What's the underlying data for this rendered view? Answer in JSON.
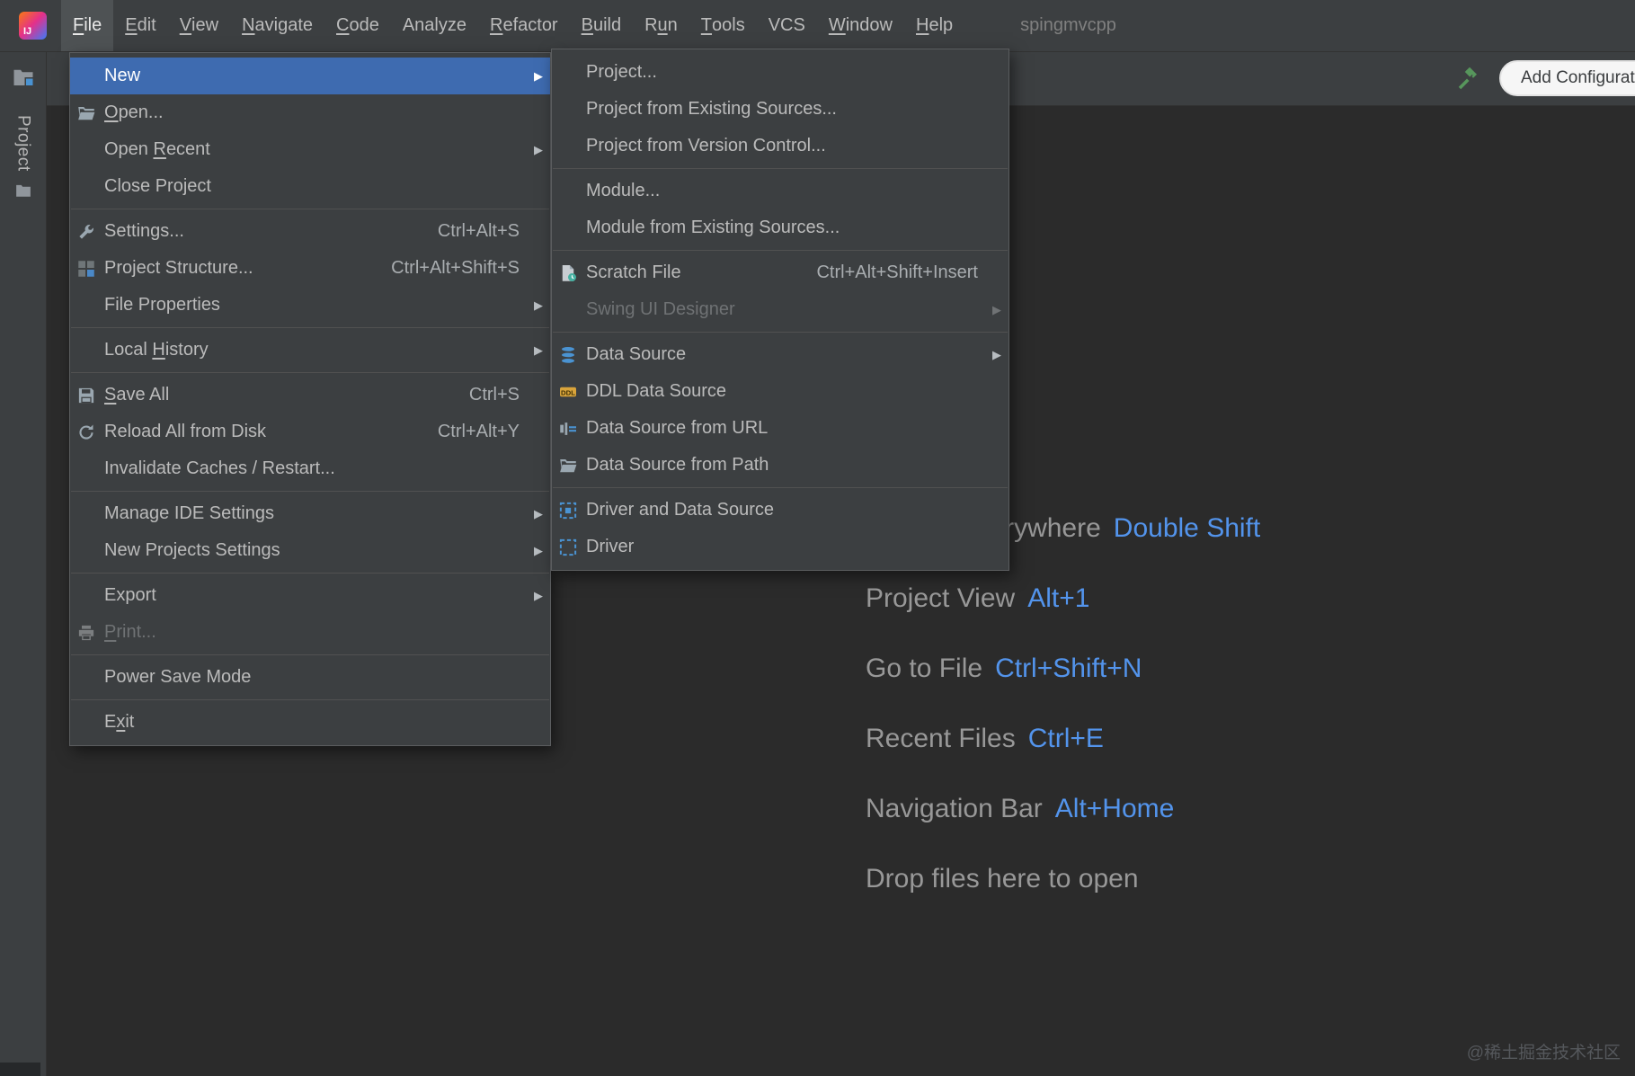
{
  "menubar": {
    "active": "File",
    "items": [
      {
        "label": "File",
        "mnemonic": 0
      },
      {
        "label": "Edit",
        "mnemonic": 0
      },
      {
        "label": "View",
        "mnemonic": 0
      },
      {
        "label": "Navigate",
        "mnemonic": 0
      },
      {
        "label": "Code",
        "mnemonic": 0
      },
      {
        "label": "Analyze",
        "mnemonic": null
      },
      {
        "label": "Refactor",
        "mnemonic": 0
      },
      {
        "label": "Build",
        "mnemonic": 0
      },
      {
        "label": "Run",
        "mnemonic": 1
      },
      {
        "label": "Tools",
        "mnemonic": 0
      },
      {
        "label": "VCS",
        "mnemonic": null
      },
      {
        "label": "Window",
        "mnemonic": 0
      },
      {
        "label": "Help",
        "mnemonic": 0
      }
    ],
    "project_name": "spingmvcpp"
  },
  "toolbar": {
    "add_config_label": "Add Configuration...",
    "hammer_icon": "hammer-icon"
  },
  "sidebar": {
    "tool_window_label": "Project"
  },
  "file_menu": {
    "items": [
      {
        "label": "New",
        "submenu": true,
        "selected": true
      },
      {
        "label": "Open...",
        "icon": "folder-open-icon",
        "mnemonic": 0
      },
      {
        "label": "Open Recent",
        "submenu": true,
        "mnemonic": 5
      },
      {
        "label": "Close Project"
      },
      {
        "separator": true
      },
      {
        "label": "Settings...",
        "icon": "wrench-icon",
        "shortcut": "Ctrl+Alt+S"
      },
      {
        "label": "Project Structure...",
        "icon": "project-structure-icon",
        "shortcut": "Ctrl+Alt+Shift+S"
      },
      {
        "label": "File Properties",
        "submenu": true
      },
      {
        "separator": true
      },
      {
        "label": "Local History",
        "submenu": true,
        "mnemonic": 6
      },
      {
        "separator": true
      },
      {
        "label": "Save All",
        "icon": "save-icon",
        "shortcut": "Ctrl+S",
        "mnemonic": 0
      },
      {
        "label": "Reload All from Disk",
        "icon": "reload-icon",
        "shortcut": "Ctrl+Alt+Y"
      },
      {
        "label": "Invalidate Caches / Restart..."
      },
      {
        "separator": true
      },
      {
        "label": "Manage IDE Settings",
        "submenu": true
      },
      {
        "label": "New Projects Settings",
        "submenu": true
      },
      {
        "separator": true
      },
      {
        "label": "Export",
        "submenu": true
      },
      {
        "label": "Print...",
        "icon": "printer-icon",
        "disabled": true,
        "mnemonic": 0
      },
      {
        "separator": true
      },
      {
        "label": "Power Save Mode"
      },
      {
        "separator": true
      },
      {
        "label": "Exit",
        "mnemonic": 1
      }
    ]
  },
  "new_submenu": {
    "items": [
      {
        "label": "Project..."
      },
      {
        "label": "Project from Existing Sources..."
      },
      {
        "label": "Project from Version Control..."
      },
      {
        "separator": true
      },
      {
        "label": "Module..."
      },
      {
        "label": "Module from Existing Sources..."
      },
      {
        "separator": true
      },
      {
        "label": "Scratch File",
        "icon": "scratch-file-icon",
        "shortcut": "Ctrl+Alt+Shift+Insert"
      },
      {
        "label": "Swing UI Designer",
        "submenu": true,
        "disabled": true
      },
      {
        "separator": true
      },
      {
        "label": "Data Source",
        "icon": "database-icon",
        "submenu": true
      },
      {
        "label": "DDL Data Source",
        "icon": "ddl-icon"
      },
      {
        "label": "Data Source from URL",
        "icon": "datasource-url-icon"
      },
      {
        "label": "Data Source from Path",
        "icon": "folder-open-icon"
      },
      {
        "separator": true
      },
      {
        "label": "Driver and Data Source",
        "icon": "driver-datasource-icon"
      },
      {
        "label": "Driver",
        "icon": "driver-icon"
      }
    ]
  },
  "empty_state": {
    "shortcuts": [
      {
        "label": "Search Everywhere",
        "key": "Double Shift"
      },
      {
        "label": "Project View",
        "key": "Alt+1"
      },
      {
        "label": "Go to File",
        "key": "Ctrl+Shift+N"
      },
      {
        "label": "Recent Files",
        "key": "Ctrl+E"
      },
      {
        "label": "Navigation Bar",
        "key": "Alt+Home"
      },
      {
        "label": "Drop files here to open",
        "key": ""
      }
    ]
  },
  "watermark": "@稀土掘金技术社区",
  "colors": {
    "menu_bg": "#3c3f41",
    "editor_bg": "#2b2b2b",
    "selection": "#3e6bb0",
    "shortcut_key_blue": "#5394ec",
    "hammer_green": "#57965c"
  }
}
